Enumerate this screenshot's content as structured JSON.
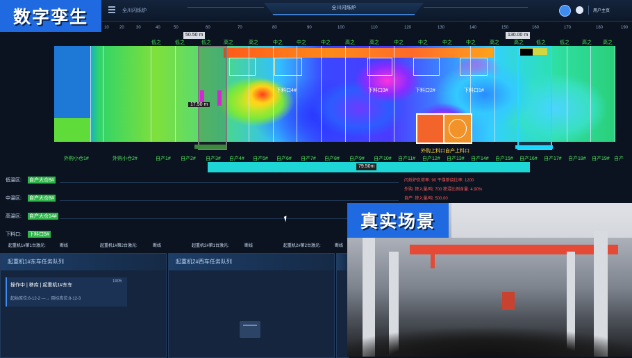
{
  "brand": {
    "title": "数字孪生"
  },
  "header": {
    "app_title": "全川闪烁炉",
    "center_tab": "全川闪烁炉",
    "logout": "用户主页"
  },
  "ruler": {
    "ticks": [
      "10",
      "20",
      "30",
      "40",
      "50",
      "60",
      "70",
      "80",
      "90",
      "100",
      "110",
      "120",
      "130",
      "140",
      "150",
      "160",
      "170",
      "180",
      "190"
    ],
    "marker_left": "50.50 m",
    "marker_right": "130.00 m"
  },
  "zones": {
    "top_labels": [
      "低之",
      "低之",
      "低之",
      "高之",
      "高之",
      "中之",
      "中之",
      "中之",
      "高之",
      "高之",
      "中之",
      "中之",
      "中之",
      "中之",
      "高之",
      "高之",
      "低之",
      "低之",
      "高之",
      "高之",
      "低之"
    ]
  },
  "ports": [
    "下料口4#",
    "下料口3#",
    "下料口2#",
    "下料口1#"
  ],
  "crane_a": {
    "position": "17.50 m"
  },
  "inbound_label": "外购上料口自产上料口",
  "bins": [
    "外购小仓1#",
    "外购小仓2#",
    "自产1#",
    "自产2#",
    "自产3#",
    "自产4#",
    "自产5#",
    "自产6#",
    "自产7#",
    "自产8#",
    "自产9#",
    "自产10#",
    "自产11#",
    "自产12#",
    "自产13#",
    "自产14#",
    "自产15#",
    "自产16#",
    "自产17#",
    "自产18#",
    "自产19#",
    "自产"
  ],
  "length_bar": {
    "value": "79.50m"
  },
  "areas": [
    {
      "label": "低温区:",
      "tag": "自产大仓8#"
    },
    {
      "label": "中温区:",
      "tag": "自产大仓8#"
    },
    {
      "label": "高温区:",
      "tag": "自产大仓14#"
    },
    {
      "label": "下料口:",
      "tag": "下料口5#"
    }
  ],
  "crane_status": [
    "起重机1#第1台激光:",
    "断线",
    "起重机1#第2台激光:",
    "断线",
    "起重机2#第1台激光:",
    "断线",
    "起重机2#第2台激光:",
    "断线"
  ],
  "stats": {
    "row1": "闪烁炉负荷率: 90    干煤掺烧比率: 1200",
    "row2": "外购:  掺入量/吨: 700    掺混比例含量: 4.90%",
    "row3": "自产:  掺入量/吨: 500.00"
  },
  "panels": {
    "p1_title": "起重机1#东车任务队列",
    "p2_title": "起重机2#西车任务队列",
    "task_title": "操作中 | 移库 | 起重机1#东车",
    "task_count": "1905",
    "task_route": "起始库位:6-12-2 —→ 目标库位:8-12-3"
  },
  "photo": {
    "label": "真实场景"
  },
  "colors": {
    "accent": "#1f6ae0",
    "zone_green": "#4ce85a",
    "bar_cyan": "#1ed6d6"
  }
}
